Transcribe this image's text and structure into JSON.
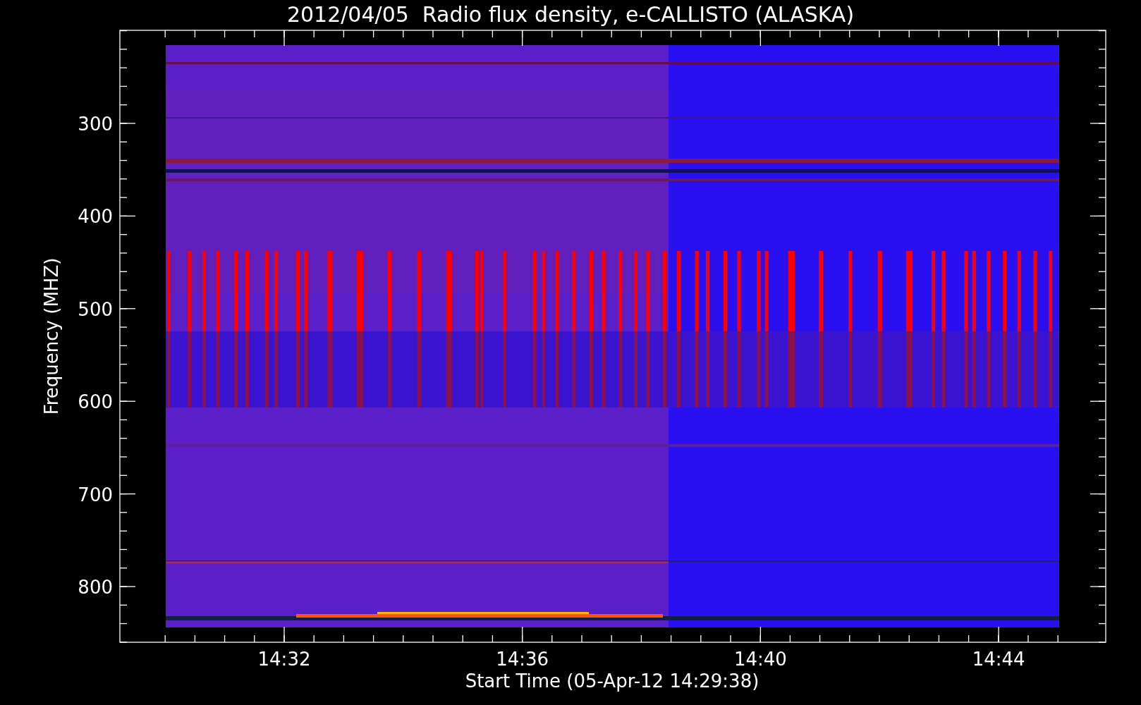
{
  "title": "2012/04/05  Radio flux density, e-CALLISTO (ALASKA)",
  "y_axis": {
    "label": "Frequency (MHZ)",
    "ticks": [
      "300",
      "400",
      "500",
      "600",
      "700",
      "800"
    ]
  },
  "x_axis": {
    "label": "Start Time (05-Apr-12 14:29:38)",
    "ticks": [
      "14:32",
      "14:36",
      "14:40",
      "14:44"
    ]
  }
}
